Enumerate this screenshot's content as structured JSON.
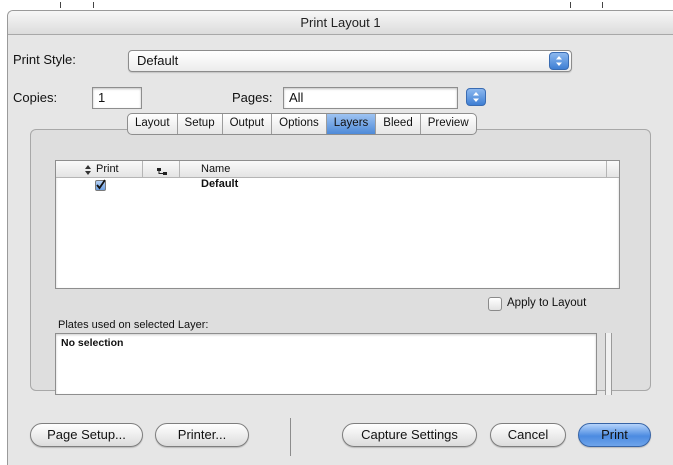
{
  "window": {
    "title": "Print Layout 1"
  },
  "print_style": {
    "label": "Print Style:",
    "value": "Default"
  },
  "copies": {
    "label": "Copies:",
    "value": "1"
  },
  "pages": {
    "label": "Pages:",
    "value": "All"
  },
  "tabs": [
    "Layout",
    "Setup",
    "Output",
    "Options",
    "Layers",
    "Bleed",
    "Preview"
  ],
  "active_tab": "Layers",
  "layers_table": {
    "columns": [
      "Print",
      "Name"
    ],
    "rows": [
      {
        "print": true,
        "name": "Default"
      }
    ]
  },
  "apply_to_layout": {
    "label": "Apply to Layout",
    "checked": false
  },
  "plates": {
    "label": "Plates used on selected Layer:",
    "value": "No selection"
  },
  "buttons": {
    "page_setup": "Page Setup...",
    "printer": "Printer...",
    "capture_settings": "Capture Settings",
    "cancel": "Cancel",
    "print": "Print"
  },
  "colors": {
    "accent": "#4e8ad8",
    "window_bg": "#e6e6e6"
  }
}
